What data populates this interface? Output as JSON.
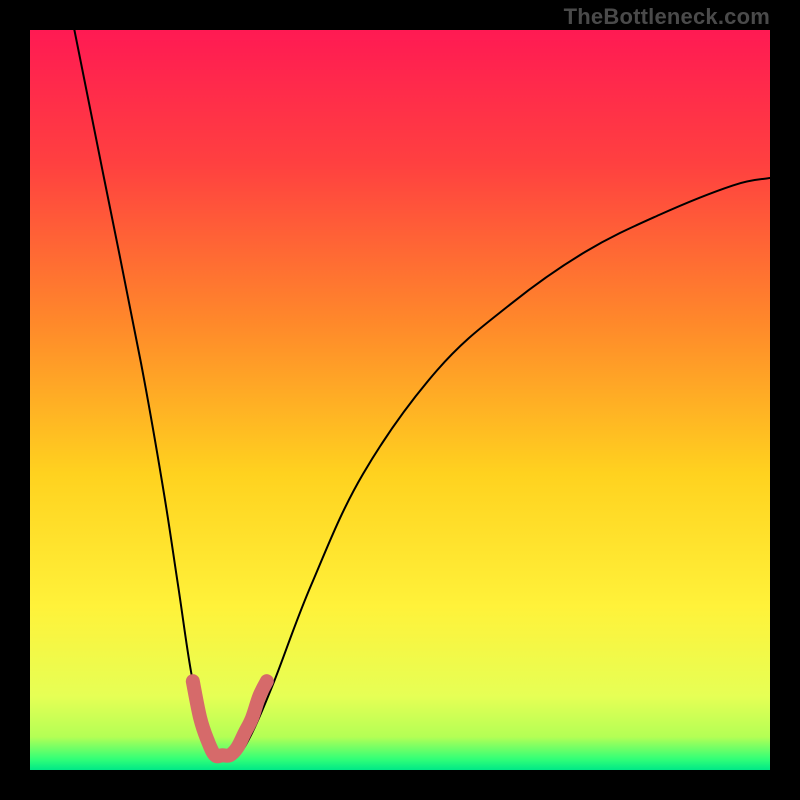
{
  "watermark": "TheBottleneck.com",
  "chart_data": {
    "type": "line",
    "title": "",
    "xlabel": "",
    "ylabel": "",
    "xlim": [
      0,
      100
    ],
    "ylim": [
      0,
      100
    ],
    "grid": false,
    "legend": false,
    "series": [
      {
        "name": "bottleneck-curve",
        "color": "#000000",
        "x": [
          6,
          10,
          15,
          18,
          20,
          22,
          24,
          26,
          28,
          30,
          33,
          38,
          45,
          55,
          65,
          75,
          85,
          95,
          100
        ],
        "y": [
          100,
          80,
          55,
          38,
          25,
          12,
          5,
          2,
          2,
          5,
          12,
          25,
          40,
          54,
          63,
          70,
          75,
          79,
          80
        ]
      },
      {
        "name": "highlight-segment",
        "color": "#d66a6a",
        "x": [
          22,
          23,
          24,
          25,
          26,
          27,
          28,
          29,
          30,
          31,
          32
        ],
        "y": [
          12,
          7,
          4,
          2,
          2,
          2,
          3,
          5,
          7,
          10,
          12
        ]
      }
    ],
    "background_gradient": {
      "stops": [
        {
          "offset": 0.0,
          "color": "#ff1a53"
        },
        {
          "offset": 0.18,
          "color": "#ff4040"
        },
        {
          "offset": 0.4,
          "color": "#ff8a2a"
        },
        {
          "offset": 0.6,
          "color": "#ffd21f"
        },
        {
          "offset": 0.78,
          "color": "#fff23a"
        },
        {
          "offset": 0.9,
          "color": "#e6ff55"
        },
        {
          "offset": 0.955,
          "color": "#b4ff55"
        },
        {
          "offset": 0.985,
          "color": "#33ff77"
        },
        {
          "offset": 1.0,
          "color": "#00e887"
        }
      ]
    }
  }
}
